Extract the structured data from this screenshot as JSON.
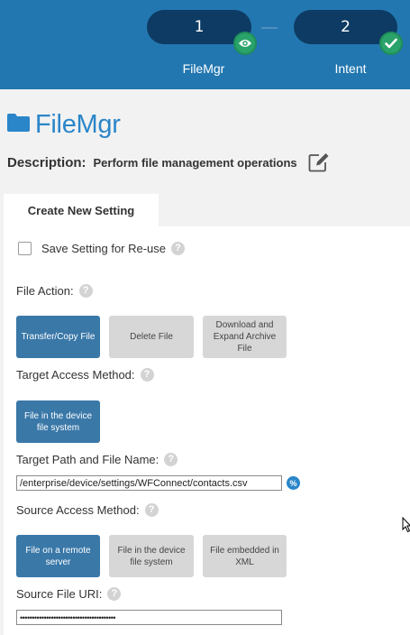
{
  "stepper": {
    "steps": [
      {
        "number": "1",
        "label": "FileMgr"
      },
      {
        "number": "2",
        "label": "Intent"
      }
    ]
  },
  "page": {
    "title": "FileMgr",
    "description_label": "Description:",
    "description_value": "Perform file management operations"
  },
  "tabs": {
    "active": "Create New Setting"
  },
  "form": {
    "save_setting_label": "Save Setting for Re-use",
    "file_action": {
      "label": "File Action:",
      "options": [
        "Transfer/Copy File",
        "Delete File",
        "Download and Expand Archive File"
      ],
      "selected": "Transfer/Copy File"
    },
    "target_access": {
      "label": "Target Access Method:",
      "options": [
        "File in the device file system"
      ],
      "selected": "File in the device file system"
    },
    "target_path": {
      "label": "Target Path and File Name:",
      "value": "/enterprise/device/settings/WFConnect/contacts.csv",
      "percent_icon_text": "%"
    },
    "source_access": {
      "label": "Source Access Method:",
      "options": [
        "File on a remote server",
        "File in the device file system",
        "File embedded in XML"
      ],
      "selected": "File on a remote server"
    },
    "source_uri": {
      "label": "Source File URI:",
      "value": "••••••••••••••••••••••••••••••••••••••••"
    },
    "help_glyph": "?"
  },
  "colors": {
    "header_bg": "#2277b0",
    "pill_bg": "#0d3b63",
    "badge_green": "#2aa36b",
    "title_blue": "#2a86c9",
    "selected_button": "#3a78a8",
    "unselected_button": "#d7d7d7"
  },
  "icons": {
    "step1_badge": "eye-icon",
    "step2_badge": "check-icon",
    "title": "folder-icon",
    "description": "edit-icon",
    "target_path": "percent-icon",
    "pointer": "mouse-cursor-icon"
  }
}
